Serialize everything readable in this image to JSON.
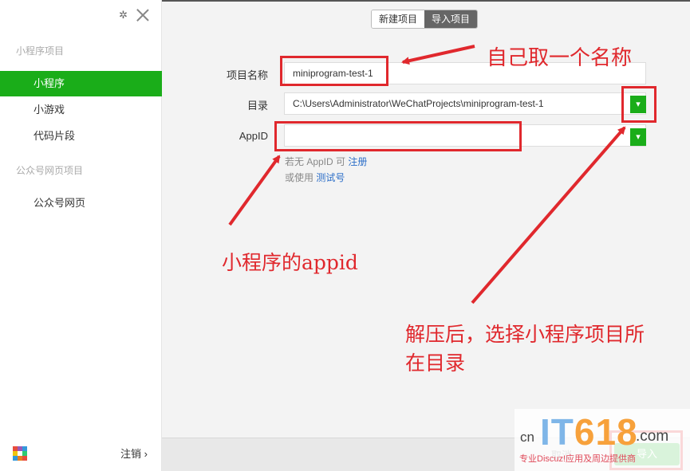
{
  "sidebar": {
    "section_miniprogram": "小程序项目",
    "items": [
      {
        "label": "小程序",
        "active": true
      },
      {
        "label": "小游戏",
        "active": false
      },
      {
        "label": "代码片段",
        "active": false
      }
    ],
    "section_official": "公众号网页项目",
    "official_items": [
      {
        "label": "公众号网页"
      }
    ],
    "logout_label": "注销 ›"
  },
  "tabs": [
    {
      "label": "新建项目",
      "active": false
    },
    {
      "label": "导入项目",
      "active": true
    }
  ],
  "form": {
    "name_label": "项目名称",
    "name_value": "miniprogram-test-1",
    "dir_label": "目录",
    "dir_value": "C:\\Users\\Administrator\\WeChatProjects\\miniprogram-test-1",
    "appid_label": "AppID",
    "appid_value": "",
    "hint1_prefix": "若无 AppID 可",
    "hint1_link": "注册",
    "hint2_prefix": "或使用",
    "hint2_link": "测试号"
  },
  "annotations": {
    "name": "自己取一个名称",
    "appid": "小程序的appid",
    "dir_line1": "解压后，选择小程序项目所",
    "dir_line2": "在目录"
  },
  "footer": {
    "cancel_label": "取消",
    "ok_label": "导入"
  },
  "watermark": {
    "cn": "cn",
    "it": "IT",
    "num": "618",
    "com": ".com",
    "sub": "专业Discuz!应用及周边提供商"
  },
  "colors": {
    "accent_green": "#1aad19",
    "annotation_red": "#e0282d",
    "link_blue": "#2b6ec8"
  },
  "icons": {
    "settings": "gear-icon",
    "close": "close-icon",
    "dropdown": "chevron-down-icon"
  }
}
